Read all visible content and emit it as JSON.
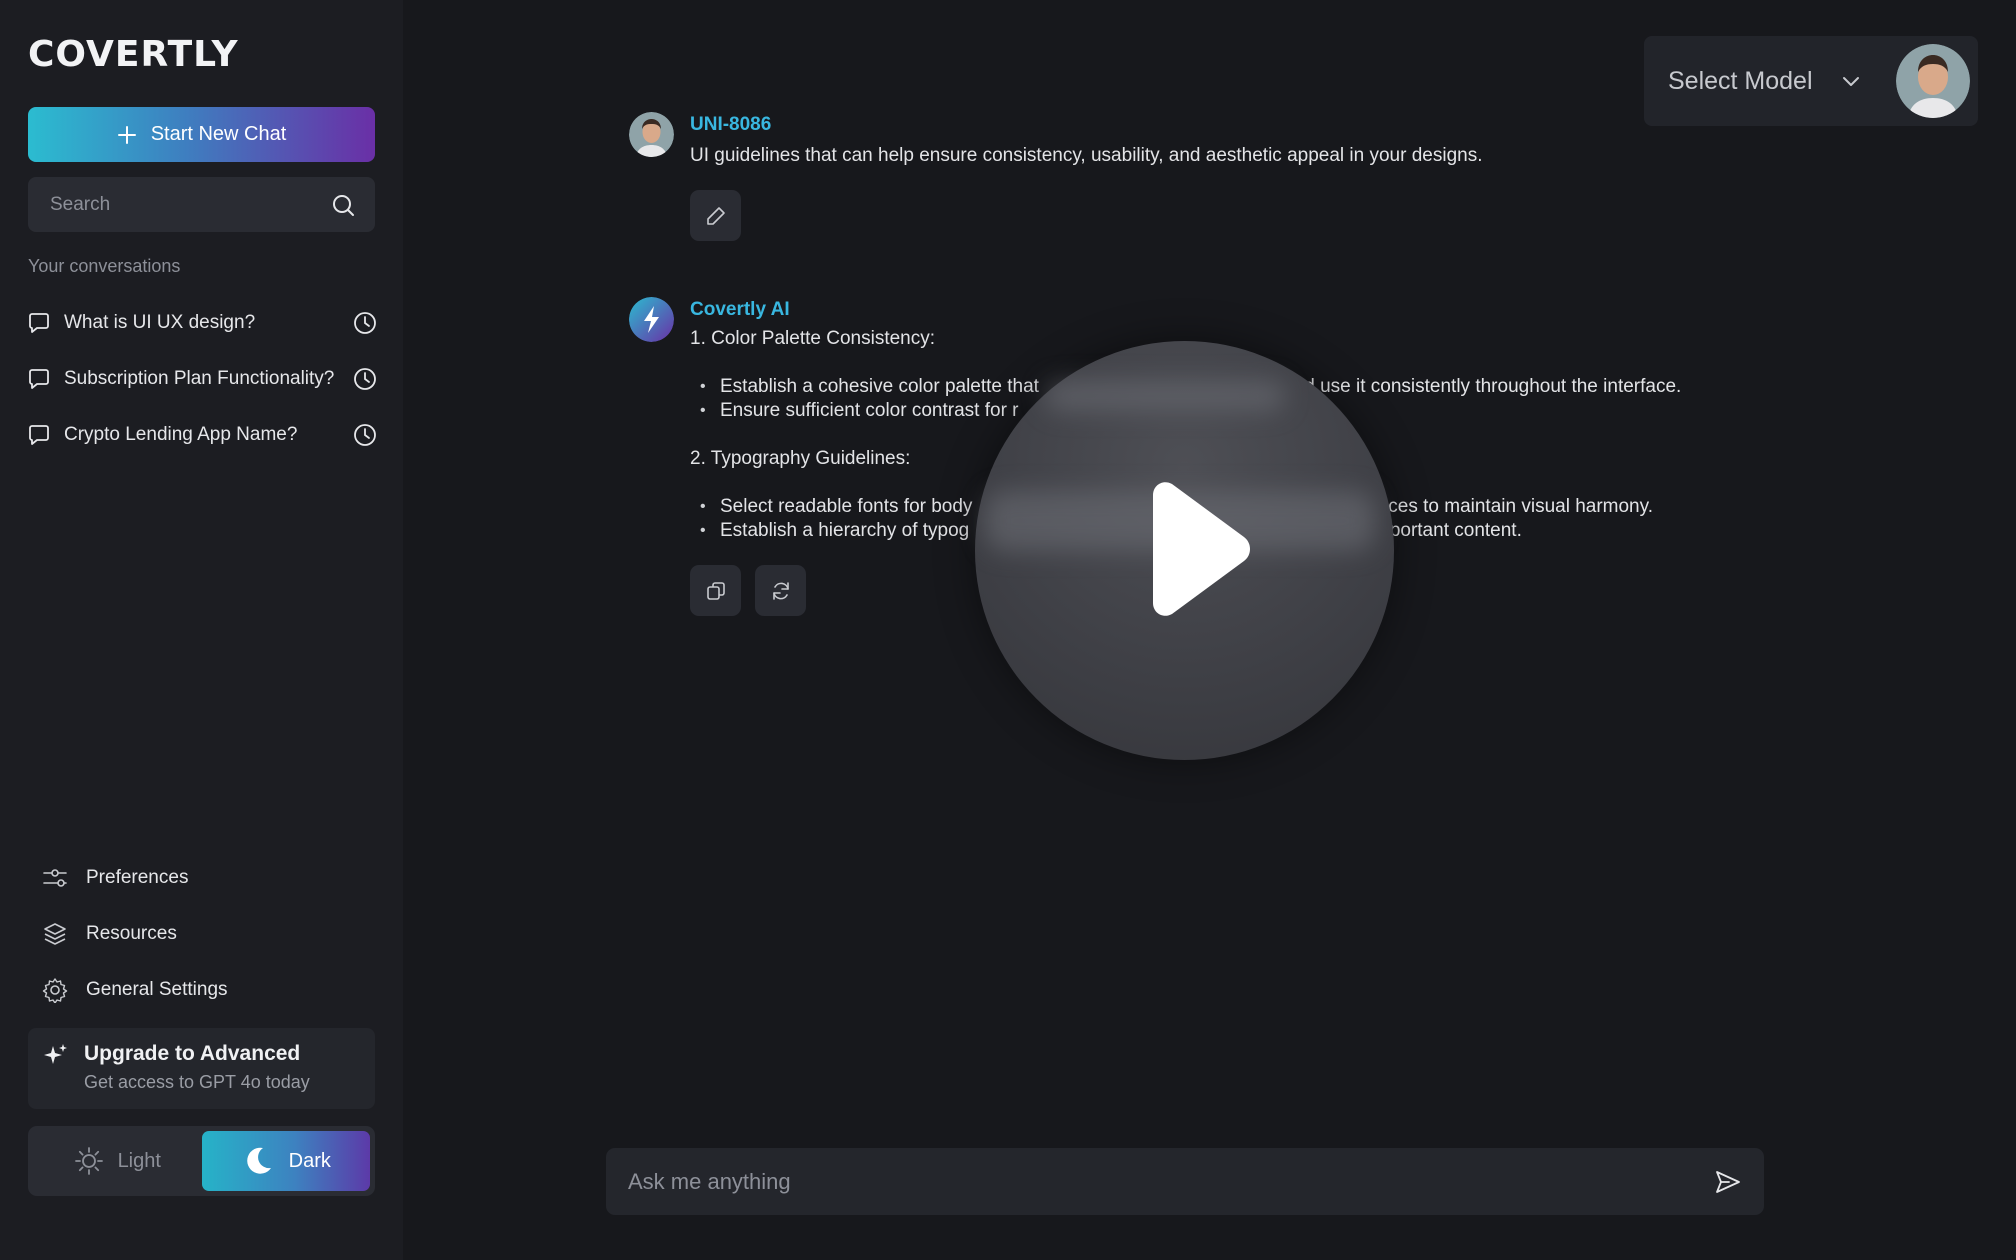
{
  "sidebar": {
    "logo": "COVERTLY",
    "new_chat_label": "Start New Chat",
    "search_placeholder": "Search",
    "conversations_heading": "Your conversations",
    "conversations": [
      {
        "label": "What is UI UX design?"
      },
      {
        "label": "Subscription Plan Functionality?"
      },
      {
        "label": "Crypto Lending App Name?"
      }
    ],
    "menu": [
      {
        "label": "Preferences",
        "icon": "sliders-icon"
      },
      {
        "label": "Resources",
        "icon": "layers-icon"
      },
      {
        "label": "General Settings",
        "icon": "gear-icon"
      }
    ],
    "upgrade": {
      "title": "Upgrade to Advanced",
      "subtitle": "Get access to GPT 4o today"
    },
    "theme": {
      "light_label": "Light",
      "dark_label": "Dark",
      "selected": "Dark"
    }
  },
  "header": {
    "model_select_label": "Select Model"
  },
  "chat": {
    "user_message": {
      "author": "UNI-8086",
      "text": "UI guidelines that can help ensure consistency, usability, and aesthetic appeal in your designs."
    },
    "ai_message": {
      "author": "Covertly AI",
      "section1_title": "1. Color Palette Consistency:",
      "section1_bullets": [
        "Establish a cohesive color palette that ",
        "Ensure sufficient color contrast for r"
      ],
      "section1_bullet1_tail": "d use it consistently throughout the interface.",
      "section2_title": "2. Typography Guidelines:",
      "section2_bullets": [
        "Select readable fonts for body",
        "Establish a hierarchy of typog"
      ],
      "section2_bullet1_tail": "faces to maintain visual harmony.",
      "section2_bullet2_tail": "nportant content."
    },
    "input_placeholder": "Ask me anything"
  },
  "colors": {
    "accent_start": "#2bbcd0",
    "accent_end": "#6a2fa6",
    "author_link": "#39b7e0",
    "background": "#17181c",
    "sidebar": "#1c1d22"
  }
}
